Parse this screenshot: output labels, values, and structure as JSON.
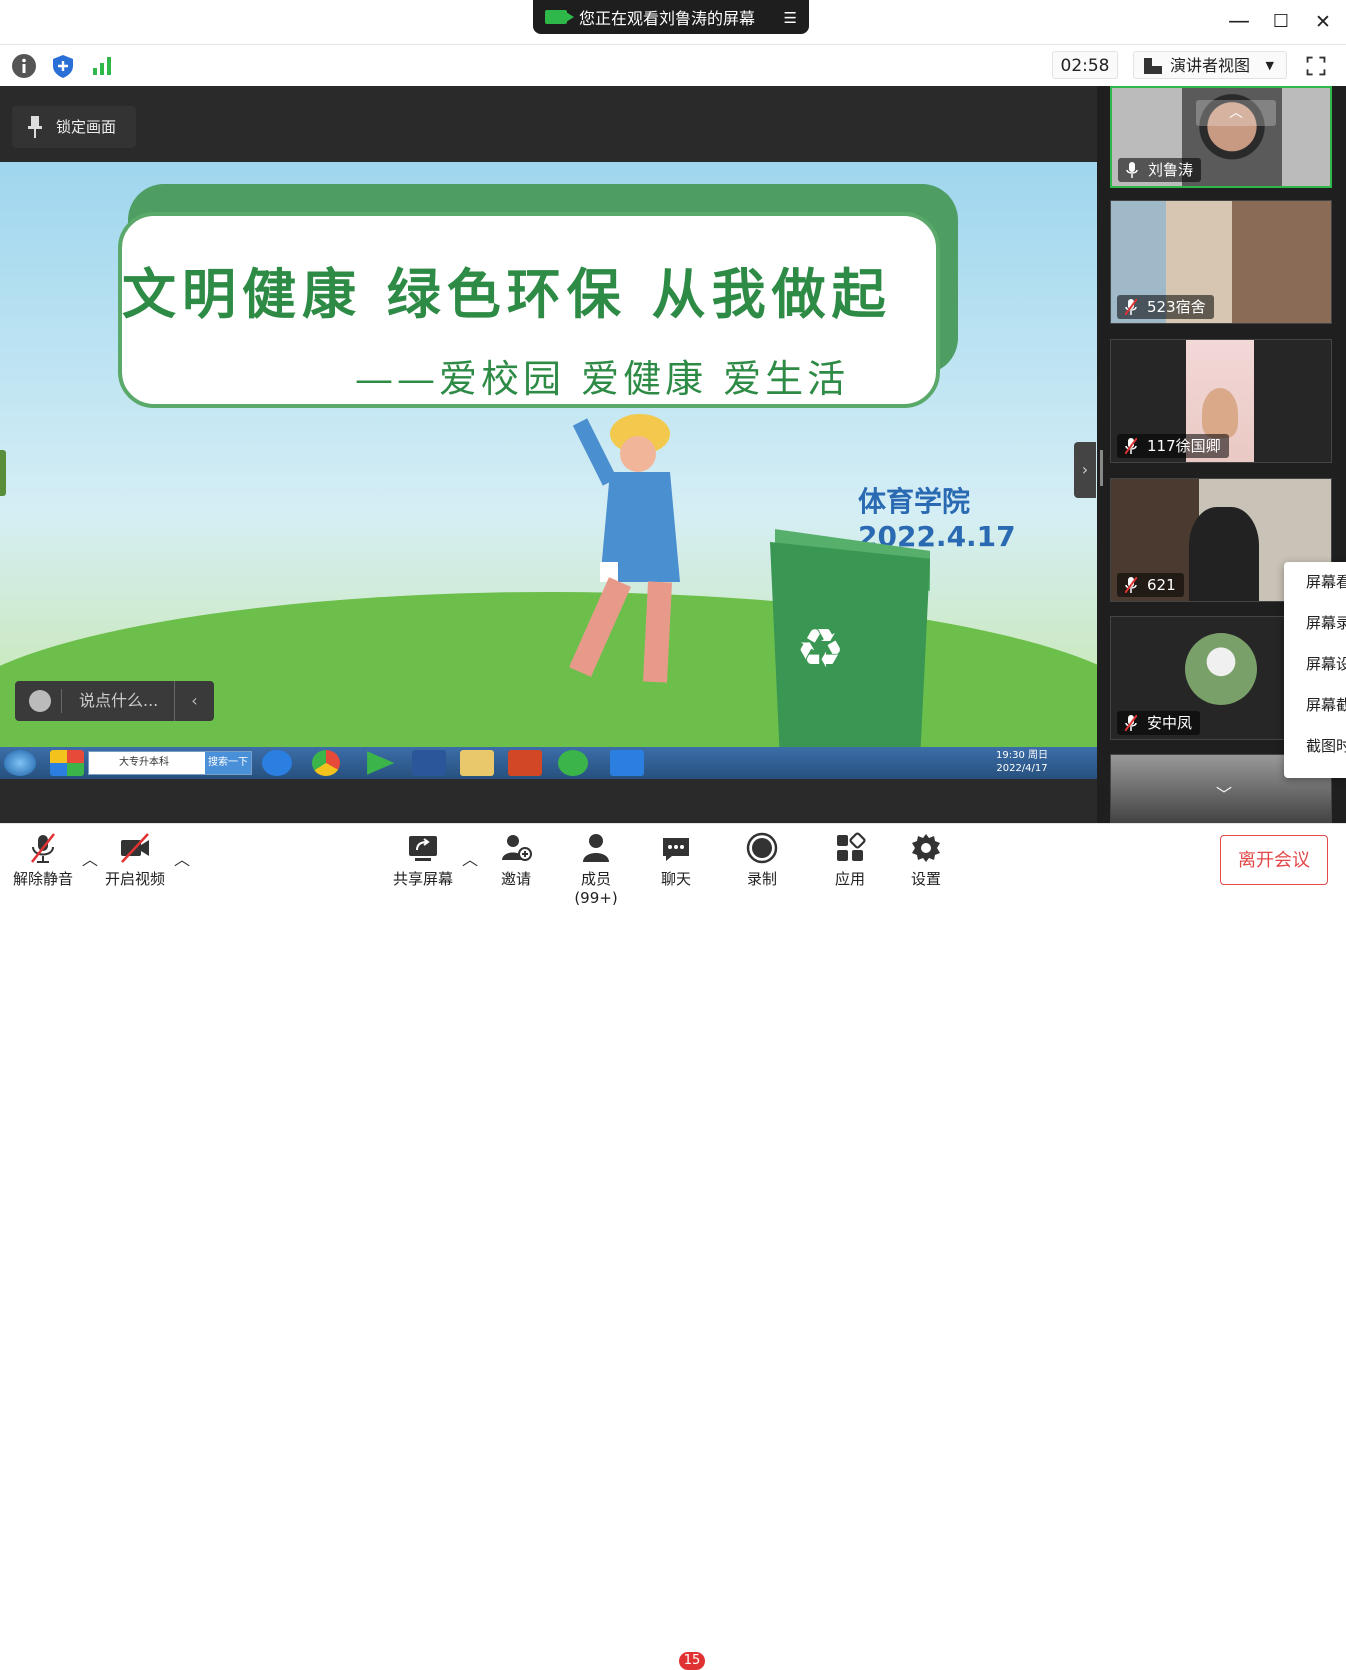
{
  "title_bar": {
    "share_notice": "您正在观看刘鲁涛的屏幕",
    "minimize": "—",
    "maximize": "☐",
    "close": "✕"
  },
  "toolbar": {
    "timer": "02:58",
    "view_mode": "演讲者视图",
    "icons": [
      "info-icon",
      "shield-icon",
      "signal-icon",
      "fullscreen-icon"
    ]
  },
  "stage": {
    "lock_label": "锁定画面",
    "slide": {
      "title": "文明健康 绿色环保 从我做起",
      "subtitle": "——爱校园 爱健康 爱生活",
      "college": "体育学院",
      "date": "2022.4.17"
    },
    "taskbar": {
      "search_text": "大专升本科",
      "search_button": "搜索一下",
      "clock_time": "19:30 周日",
      "clock_date": "2022/4/17"
    },
    "chat_input_placeholder": "说点什么..."
  },
  "participants": [
    {
      "name": "刘鲁涛",
      "muted": false
    },
    {
      "name": "523宿舍",
      "muted": true
    },
    {
      "name": "117徐国卿",
      "muted": true
    },
    {
      "name": "621",
      "muted": true
    },
    {
      "name": "安中凤",
      "muted": true
    }
  ],
  "context_menu": [
    "屏幕看",
    "屏幕录",
    "屏幕设",
    "屏幕截",
    "截图时"
  ],
  "bottom_bar": {
    "unmute": "解除静音",
    "start_video": "开启视频",
    "share_screen": "共享屏幕",
    "invite": "邀请",
    "members": "成员(99+)",
    "chat": "聊天",
    "chat_badge": "15",
    "record": "录制",
    "apps": "应用",
    "settings": "设置",
    "leave": "离开会议"
  },
  "colors": {
    "accent_green": "#2fb84a",
    "leave_red": "#e24848",
    "badge_red": "#e03232"
  }
}
